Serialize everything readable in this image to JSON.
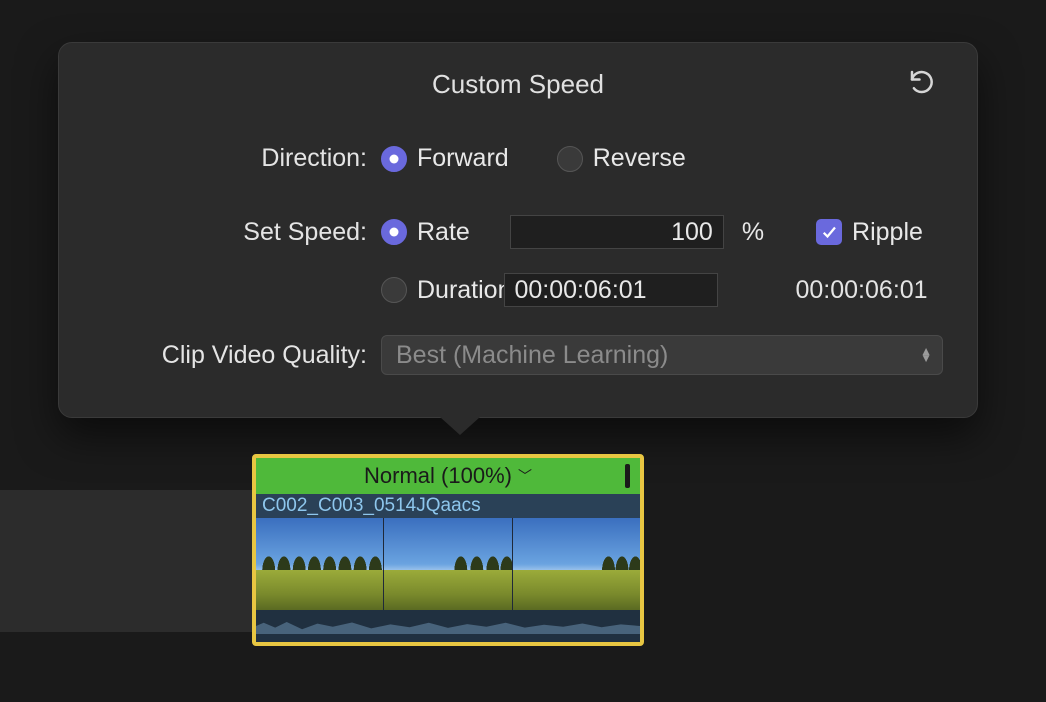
{
  "popover": {
    "title": "Custom Speed",
    "direction": {
      "label": "Direction:",
      "forward": "Forward",
      "reverse": "Reverse",
      "selected": "forward"
    },
    "speed": {
      "label": "Set Speed:",
      "rate_label": "Rate",
      "rate_value": "100",
      "rate_unit": "%",
      "duration_label": "Duration",
      "duration_value": "00:00:06:01",
      "duration_readout": "00:00:06:01",
      "selected": "rate",
      "ripple_label": "Ripple",
      "ripple_checked": true
    },
    "quality": {
      "label": "Clip Video Quality:",
      "selected": "Best (Machine Learning)"
    }
  },
  "clip": {
    "speed_badge": "Normal (100%)",
    "name": "C002_C003_0514JQaacs"
  }
}
